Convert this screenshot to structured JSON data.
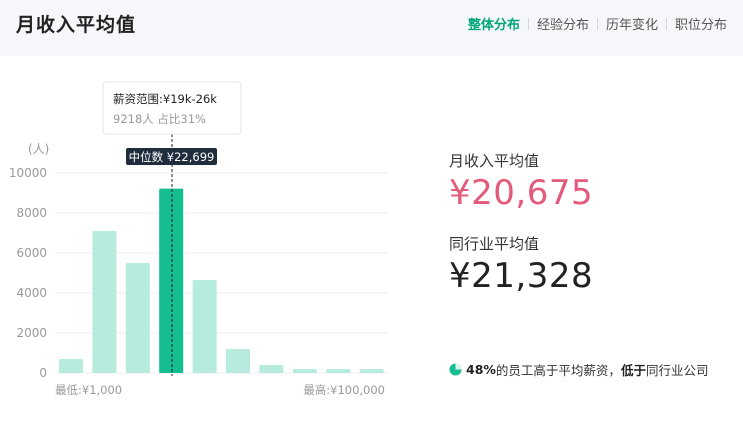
{
  "header": {
    "title": "月收入平均值",
    "tabs": [
      {
        "label": "整体分布",
        "active": true
      },
      {
        "label": "经验分布",
        "active": false
      },
      {
        "label": "历年变化",
        "active": false
      },
      {
        "label": "职位分布",
        "active": false
      }
    ]
  },
  "chart_data": {
    "type": "bar",
    "ylabel": "(人)",
    "ylim": [
      0,
      10000
    ],
    "yticks": [
      0,
      2000,
      4000,
      6000,
      8000,
      10000
    ],
    "grid": true,
    "values": [
      700,
      7100,
      5500,
      9218,
      4650,
      1200,
      400,
      200,
      200,
      200
    ],
    "highlight_index": 3,
    "highlight_color": "#15be90",
    "bar_color": "#b6ebdd",
    "x_min_label": "最低:¥1,000",
    "x_max_label": "最高:¥100,000",
    "tooltip": {
      "title": "薪资范围:¥19k-26k",
      "detail": "9218人  占比31%"
    },
    "median_label": "中位数 ¥22,699"
  },
  "stats": {
    "avg_label": "月收入平均值",
    "avg_value": "¥20,675",
    "avg_color": "#e45a7a",
    "industry_label": "同行业平均值",
    "industry_value": "¥21,328"
  },
  "summary": {
    "icon": "pie-chart-icon",
    "percent": "48%",
    "text1": "的员工高于平均薪资，",
    "bold": "低于",
    "text2": "同行业公司"
  }
}
